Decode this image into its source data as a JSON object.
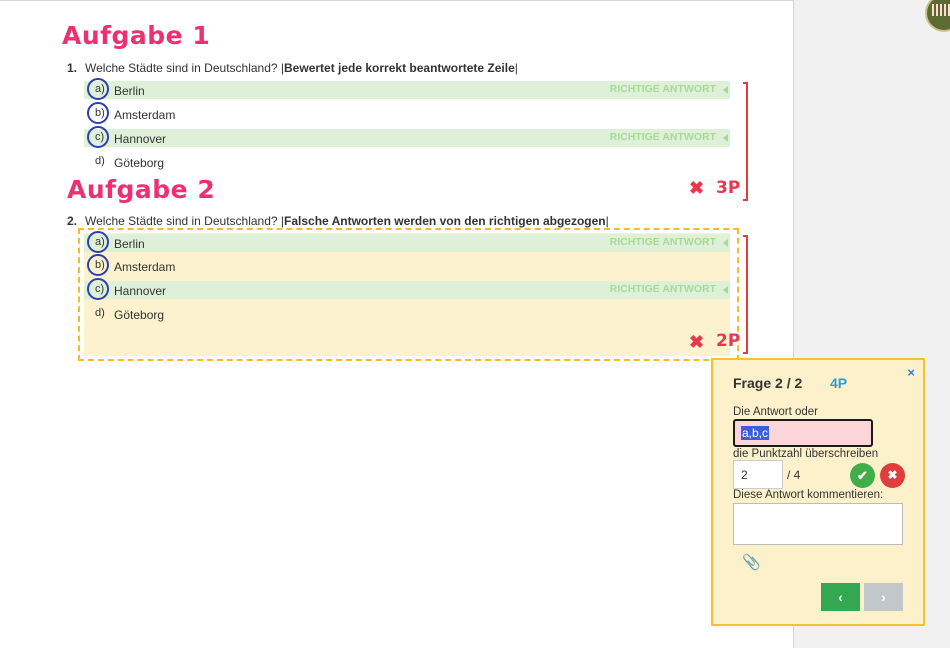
{
  "task1": {
    "heading": "Aufgabe 1",
    "number": "1.",
    "question": "Welche Städte sind in Deutschland? |",
    "question_bold": "Bewertet jede korrekt beantwortete Zeile",
    "question_end": "|",
    "answers": [
      {
        "letter": "a)",
        "text": "Berlin",
        "label": "RICHTIGE ANTWORT"
      },
      {
        "letter": "b)",
        "text": "Amsterdam",
        "label": ""
      },
      {
        "letter": "c)",
        "text": "Hannover",
        "label": "RICHTIGE ANTWORT"
      },
      {
        "letter": "d)",
        "text": "Göteborg",
        "label": ""
      }
    ],
    "score": "3P"
  },
  "task2": {
    "heading": "Aufgabe 2",
    "number": "2.",
    "question": "Welche Städte sind in Deutschland? |",
    "question_bold": "Falsche Antworten werden von den richtigen abgezogen",
    "question_end": "|",
    "answers": [
      {
        "letter": "a)",
        "text": "Berlin",
        "label": "RICHTIGE ANTWORT"
      },
      {
        "letter": "b)",
        "text": "Amsterdam",
        "label": ""
      },
      {
        "letter": "c)",
        "text": "Hannover",
        "label": "RICHTIGE ANTWORT"
      },
      {
        "letter": "d)",
        "text": "Göteborg",
        "label": ""
      }
    ],
    "score": "2P"
  },
  "panel": {
    "title": "Frage 2 / 2",
    "points": "4P",
    "close_icon": "×",
    "answer_label": "Die Antwort oder",
    "answer_value": "a,b,c",
    "override_label": "die Punktzahl überschreiben",
    "points_value": "2",
    "points_max": "/ 4",
    "comment_label": "Diese Antwort kommentieren:",
    "comment_value": "",
    "confirm_icon": "✔",
    "reject_icon": "✖",
    "attach_icon": "📎",
    "prev_icon": "‹",
    "next_icon": "›"
  },
  "colors": {
    "heading": "#ee2f72",
    "correct_row": "#dff0d8",
    "dashed_box": "#f5bd1f",
    "score": "#e8384f",
    "points_accent": "#2a9fd6"
  }
}
